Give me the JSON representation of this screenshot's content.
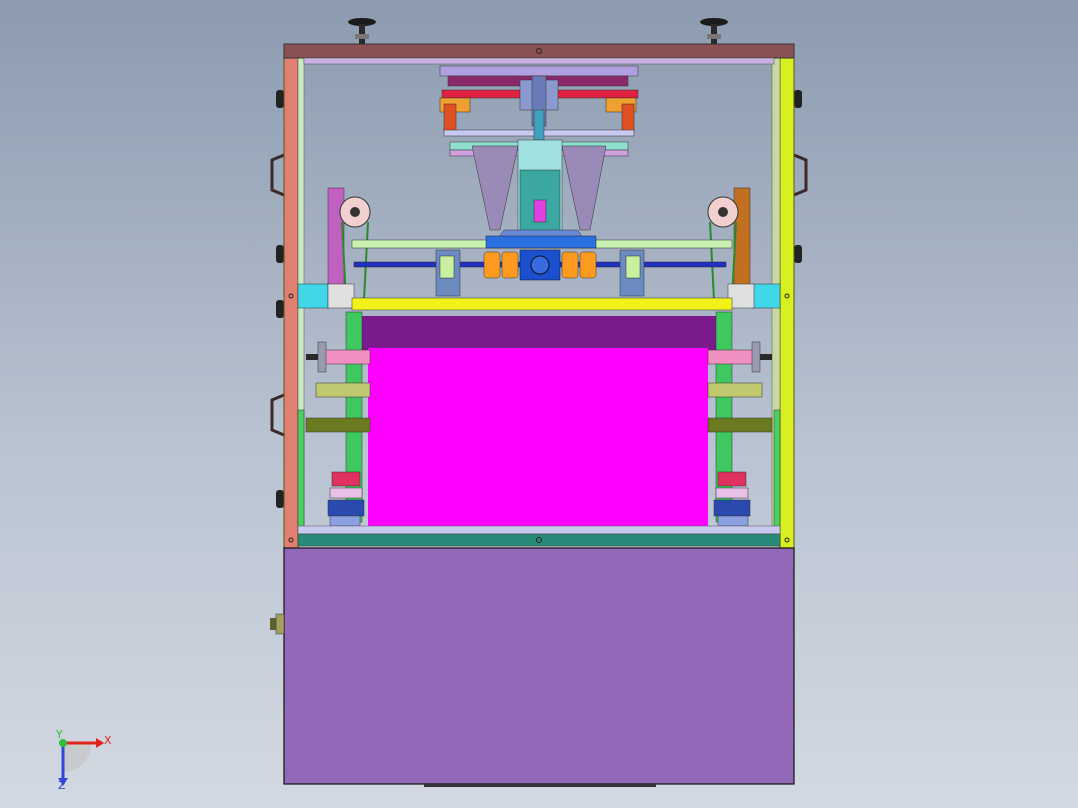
{
  "viewport": {
    "background_top": "#8c9bb0",
    "background_bottom": "#d3d9e2"
  },
  "triad": {
    "x_label": "X",
    "y_label": "Y",
    "z_label": "Z",
    "x_color": "#e0241b",
    "y_color": "#2fbf3a",
    "z_color": "#3346d8"
  },
  "colors": {
    "film": "#ff00ff",
    "film_shade": "#7a1a8c",
    "base_cabinet": "#9368b8",
    "frame_left": "#e08070",
    "frame_right": "#d8f020",
    "top_beam": "#8a5252",
    "bottom_beam": "#2a8a7a",
    "main_bar": "#f2f21a",
    "coupling": "#ff9a20",
    "motor_block": "#1a4fd0",
    "bracket_cyan": "#40d8e8"
  }
}
